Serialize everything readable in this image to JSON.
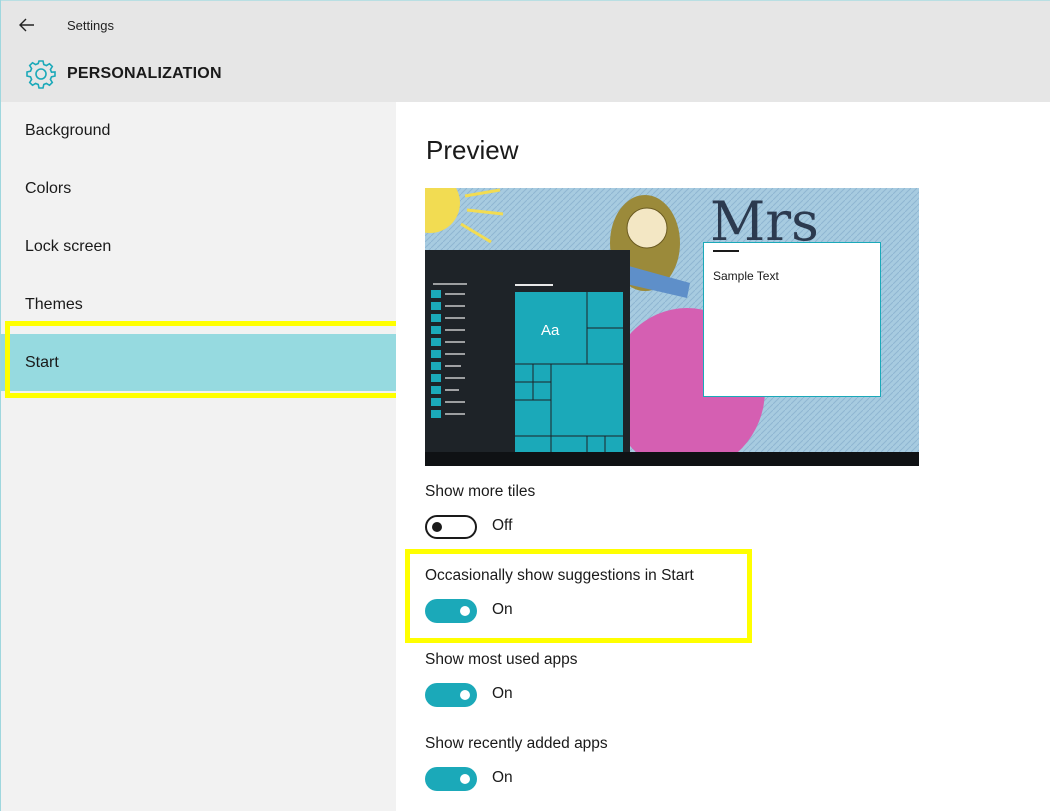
{
  "window": {
    "title": "Settings"
  },
  "header": {
    "section_title": "PERSONALIZATION",
    "icon": "gear-icon"
  },
  "sidebar": {
    "items": [
      {
        "label": "Background"
      },
      {
        "label": "Colors"
      },
      {
        "label": "Lock screen"
      },
      {
        "label": "Themes"
      },
      {
        "label": "Start",
        "selected": true
      }
    ]
  },
  "main": {
    "preview_heading": "Preview",
    "preview": {
      "tile_label": "Aa",
      "sample_text": "Sample Text",
      "wallpaper_text": "Mrs"
    },
    "settings": [
      {
        "label": "Show more tiles",
        "state": "Off"
      },
      {
        "label": "Occasionally show suggestions in Start",
        "state": "On"
      },
      {
        "label": "Show most used apps",
        "state": "On"
      },
      {
        "label": "Show recently added apps",
        "state": "On"
      }
    ]
  },
  "colors": {
    "accent": "#1ba9b9",
    "selected_nav": "#96dae0",
    "highlight": "#ffff00"
  }
}
